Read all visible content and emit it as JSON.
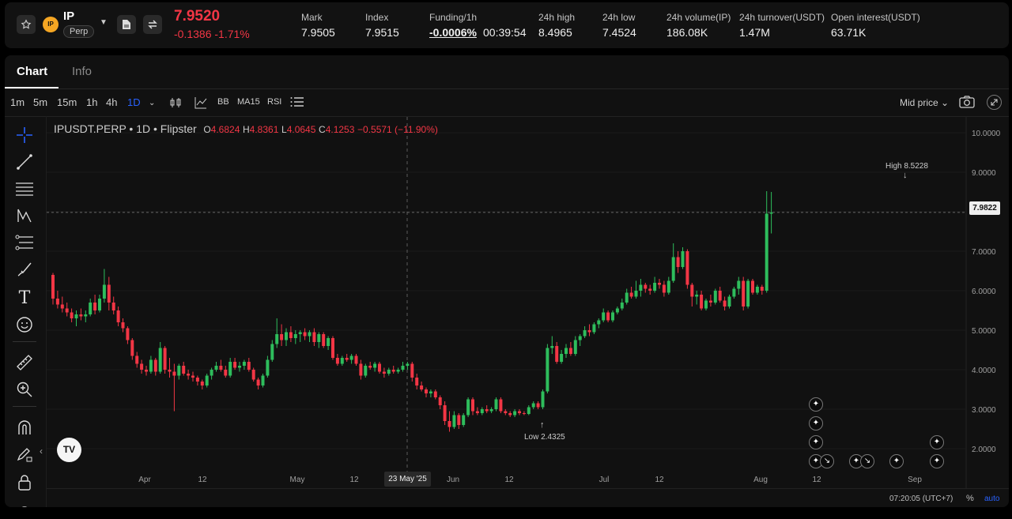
{
  "ticker": {
    "symbol": "IP",
    "type_badge": "Perp",
    "last_price": "7.9520",
    "change": "-0.1386",
    "change_pct": "-1.71%",
    "stats": [
      {
        "label": "Mark",
        "value": "7.9505"
      },
      {
        "label": "Index",
        "value": "7.9515"
      },
      {
        "label": "Funding/1h",
        "value": "-0.0006%",
        "extra": "00:39:54"
      },
      {
        "label": "24h high",
        "value": "8.4965"
      },
      {
        "label": "24h low",
        "value": "7.4524"
      },
      {
        "label": "24h volume(IP)",
        "value": "186.08K"
      },
      {
        "label": "24h turnover(USDT)",
        "value": "1.47M"
      },
      {
        "label": "Open interest(USDT)",
        "value": "63.71K"
      }
    ]
  },
  "tabs": [
    "Chart",
    "Info"
  ],
  "toolbar": {
    "intervals": [
      "1m",
      "5m",
      "15m",
      "1h",
      "4h",
      "1D"
    ],
    "active_interval": "1D",
    "indicators": [
      "BB",
      "MA15",
      "RSI"
    ],
    "price_source": "Mid price"
  },
  "legend": {
    "title": "IPUSDT.PERP • 1D • Flipster",
    "o_label": "O",
    "o": "4.6824",
    "h_label": "H",
    "h": "4.8361",
    "l_label": "L",
    "l": "4.0645",
    "c_label": "C",
    "c": "4.1253",
    "change": "−0.5571 (−11.90%)"
  },
  "annotations": {
    "high": "High 8.5228",
    "low": "Low 2.4325"
  },
  "crosshair_date": "23 May '25",
  "current_price_label": "7.9822",
  "footer": {
    "time": "07:20:05 (UTC+7)",
    "pct": "%",
    "auto": "auto"
  },
  "colors": {
    "up": "#2ebd5c",
    "down": "#f23645",
    "accent": "#2962ff",
    "bg": "#111111"
  },
  "chart_data": {
    "type": "candlestick",
    "y_ticks": [
      "10.0000",
      "9.0000",
      "8.0000",
      "7.0000",
      "6.0000",
      "5.0000",
      "4.0000",
      "3.0000",
      "2.0000"
    ],
    "ylim": [
      1.0,
      10.4
    ],
    "x_ticks": [
      "Apr",
      "12",
      "May",
      "12",
      "Jun",
      "12",
      "Jul",
      "12",
      "Aug",
      "12",
      "Sep"
    ],
    "candles": [
      [
        6.4,
        6.45,
        5.65,
        5.8
      ],
      [
        5.8,
        6.0,
        5.55,
        5.65
      ],
      [
        5.65,
        5.85,
        5.45,
        5.55
      ],
      [
        5.55,
        5.7,
        5.35,
        5.45
      ],
      [
        5.45,
        5.55,
        5.2,
        5.3
      ],
      [
        5.3,
        5.5,
        5.1,
        5.4
      ],
      [
        5.4,
        5.55,
        5.25,
        5.35
      ],
      [
        5.35,
        5.5,
        5.2,
        5.4
      ],
      [
        5.4,
        5.8,
        5.35,
        5.7
      ],
      [
        5.7,
        5.9,
        5.4,
        5.5
      ],
      [
        5.5,
        5.9,
        5.45,
        5.8
      ],
      [
        5.8,
        6.55,
        5.7,
        6.15
      ],
      [
        6.15,
        6.35,
        5.5,
        5.7
      ],
      [
        5.7,
        5.85,
        5.4,
        5.5
      ],
      [
        5.5,
        5.6,
        5.1,
        5.2
      ],
      [
        5.2,
        5.3,
        4.95,
        5.05
      ],
      [
        5.05,
        5.1,
        4.65,
        4.75
      ],
      [
        4.75,
        4.8,
        4.25,
        4.35
      ],
      [
        4.35,
        4.45,
        4.05,
        4.15
      ],
      [
        4.15,
        4.25,
        3.9,
        4.0
      ],
      [
        4.0,
        4.1,
        3.85,
        3.95
      ],
      [
        3.95,
        4.35,
        3.9,
        4.25
      ],
      [
        4.25,
        4.3,
        3.85,
        3.95
      ],
      [
        3.95,
        4.7,
        3.9,
        4.55
      ],
      [
        4.55,
        4.6,
        3.9,
        4.0
      ],
      [
        4.0,
        4.3,
        3.8,
        3.95
      ],
      [
        3.95,
        4.15,
        2.95,
        3.85
      ],
      [
        3.85,
        4.15,
        3.75,
        4.1
      ],
      [
        4.1,
        4.2,
        3.85,
        3.9
      ],
      [
        3.9,
        4.0,
        3.75,
        3.85
      ],
      [
        3.85,
        3.95,
        3.7,
        3.8
      ],
      [
        3.8,
        3.85,
        3.6,
        3.7
      ],
      [
        3.7,
        3.75,
        3.5,
        3.6
      ],
      [
        3.6,
        3.9,
        3.55,
        3.85
      ],
      [
        3.85,
        4.05,
        3.75,
        4.0
      ],
      [
        4.0,
        4.2,
        3.95,
        4.1
      ],
      [
        4.1,
        4.25,
        3.95,
        4.0
      ],
      [
        4.0,
        4.1,
        3.8,
        3.85
      ],
      [
        3.85,
        4.3,
        3.8,
        4.2
      ],
      [
        4.2,
        4.3,
        4.0,
        4.05
      ],
      [
        4.05,
        4.2,
        3.95,
        4.1
      ],
      [
        4.1,
        4.25,
        4.0,
        4.2
      ],
      [
        4.2,
        4.3,
        3.95,
        4.0
      ],
      [
        4.0,
        4.05,
        3.7,
        3.75
      ],
      [
        3.75,
        3.8,
        3.5,
        3.6
      ],
      [
        3.6,
        3.9,
        3.55,
        3.85
      ],
      [
        3.85,
        4.35,
        3.8,
        4.25
      ],
      [
        4.25,
        4.75,
        4.2,
        4.65
      ],
      [
        4.65,
        5.3,
        4.55,
        4.9
      ],
      [
        4.9,
        5.15,
        4.6,
        4.75
      ],
      [
        4.75,
        5.05,
        4.6,
        4.95
      ],
      [
        4.95,
        5.1,
        4.7,
        4.8
      ],
      [
        4.8,
        5.0,
        4.65,
        4.9
      ],
      [
        4.9,
        5.0,
        4.7,
        4.95
      ],
      [
        4.95,
        5.05,
        4.75,
        4.85
      ],
      [
        4.85,
        5.0,
        4.7,
        4.95
      ],
      [
        4.95,
        5.05,
        4.6,
        4.7
      ],
      [
        4.7,
        4.95,
        4.55,
        4.9
      ],
      [
        4.9,
        4.95,
        4.55,
        4.6
      ],
      [
        4.6,
        4.85,
        4.5,
        4.8
      ],
      [
        4.8,
        4.85,
        4.25,
        4.3
      ],
      [
        4.3,
        4.4,
        4.1,
        4.15
      ],
      [
        4.15,
        4.35,
        4.1,
        4.3
      ],
      [
        4.3,
        4.4,
        4.2,
        4.25
      ],
      [
        4.25,
        4.4,
        4.15,
        4.35
      ],
      [
        4.35,
        4.4,
        4.1,
        4.15
      ],
      [
        4.15,
        4.25,
        3.75,
        3.85
      ],
      [
        3.85,
        4.15,
        3.8,
        4.1
      ],
      [
        4.1,
        4.2,
        4.0,
        4.05
      ],
      [
        4.05,
        4.2,
        3.95,
        4.15
      ],
      [
        4.15,
        4.2,
        3.9,
        3.95
      ],
      [
        3.95,
        4.05,
        3.8,
        3.9
      ],
      [
        3.9,
        4.05,
        3.85,
        4.0
      ],
      [
        4.0,
        4.1,
        3.9,
        3.95
      ],
      [
        3.95,
        4.05,
        3.9,
        4.0
      ],
      [
        4.0,
        4.2,
        3.95,
        4.1
      ],
      [
        4.1,
        4.2,
        4.0,
        4.15
      ],
      [
        4.15,
        4.2,
        3.7,
        3.8
      ],
      [
        3.8,
        3.9,
        3.5,
        3.6
      ],
      [
        3.6,
        3.7,
        3.45,
        3.5
      ],
      [
        3.5,
        3.55,
        3.3,
        3.4
      ],
      [
        3.4,
        3.5,
        3.3,
        3.45
      ],
      [
        3.45,
        3.5,
        3.25,
        3.3
      ],
      [
        3.3,
        3.35,
        3.0,
        3.1
      ],
      [
        3.1,
        3.2,
        2.6,
        2.7
      ],
      [
        2.7,
        2.95,
        2.43,
        2.55
      ],
      [
        2.55,
        2.95,
        2.5,
        2.85
      ],
      [
        2.85,
        2.9,
        2.5,
        2.6
      ],
      [
        2.6,
        2.9,
        2.55,
        2.85
      ],
      [
        2.85,
        3.3,
        2.8,
        3.25
      ],
      [
        3.25,
        3.3,
        2.85,
        2.95
      ],
      [
        2.95,
        3.05,
        2.85,
        2.9
      ],
      [
        2.9,
        3.05,
        2.85,
        3.0
      ],
      [
        3.0,
        3.1,
        2.9,
        2.95
      ],
      [
        2.95,
        3.05,
        2.9,
        3.0
      ],
      [
        3.0,
        3.3,
        2.95,
        3.25
      ],
      [
        3.25,
        3.3,
        2.9,
        2.95
      ],
      [
        2.95,
        3.0,
        2.85,
        2.9
      ],
      [
        2.9,
        2.95,
        2.8,
        2.85
      ],
      [
        2.85,
        3.0,
        2.8,
        2.95
      ],
      [
        2.95,
        3.0,
        2.85,
        2.9
      ],
      [
        2.9,
        2.95,
        2.85,
        2.88
      ],
      [
        2.88,
        3.1,
        2.85,
        3.05
      ],
      [
        3.05,
        3.2,
        3.0,
        3.15
      ],
      [
        3.15,
        3.2,
        3.0,
        3.05
      ],
      [
        3.05,
        3.5,
        3.0,
        3.45
      ],
      [
        3.45,
        4.65,
        3.4,
        4.55
      ],
      [
        4.55,
        4.85,
        4.4,
        4.6
      ],
      [
        4.6,
        4.7,
        4.15,
        4.2
      ],
      [
        4.2,
        4.5,
        4.15,
        4.4
      ],
      [
        4.4,
        4.65,
        4.3,
        4.55
      ],
      [
        4.55,
        4.7,
        4.35,
        4.4
      ],
      [
        4.4,
        4.85,
        4.35,
        4.75
      ],
      [
        4.75,
        4.9,
        4.6,
        4.85
      ],
      [
        4.85,
        5.1,
        4.8,
        5.0
      ],
      [
        5.0,
        5.15,
        4.85,
        4.95
      ],
      [
        4.95,
        5.2,
        4.9,
        5.15
      ],
      [
        5.15,
        5.3,
        5.05,
        5.25
      ],
      [
        5.25,
        5.55,
        5.2,
        5.45
      ],
      [
        5.45,
        5.5,
        5.2,
        5.25
      ],
      [
        5.25,
        5.5,
        5.2,
        5.45
      ],
      [
        5.45,
        5.6,
        5.4,
        5.55
      ],
      [
        5.55,
        5.8,
        5.5,
        5.7
      ],
      [
        5.7,
        6.05,
        5.65,
        5.95
      ],
      [
        5.95,
        6.1,
        5.8,
        5.85
      ],
      [
        5.85,
        6.25,
        5.8,
        6.0
      ],
      [
        6.0,
        6.3,
        5.85,
        6.15
      ],
      [
        6.15,
        6.2,
        5.95,
        6.05
      ],
      [
        6.05,
        6.15,
        5.9,
        6.0
      ],
      [
        6.0,
        6.35,
        5.95,
        6.2
      ],
      [
        6.2,
        6.3,
        6.05,
        6.15
      ],
      [
        6.15,
        6.25,
        5.85,
        5.95
      ],
      [
        5.95,
        6.35,
        5.9,
        6.25
      ],
      [
        6.25,
        7.2,
        6.2,
        6.85
      ],
      [
        6.85,
        7.0,
        6.45,
        6.6
      ],
      [
        6.6,
        7.1,
        6.55,
        7.0
      ],
      [
        7.0,
        7.05,
        6.05,
        6.15
      ],
      [
        6.15,
        6.2,
        5.6,
        5.85
      ],
      [
        5.85,
        6.0,
        5.65,
        5.9
      ],
      [
        5.9,
        6.0,
        5.5,
        5.55
      ],
      [
        5.55,
        5.8,
        5.5,
        5.75
      ],
      [
        5.75,
        5.9,
        5.6,
        5.7
      ],
      [
        5.7,
        6.05,
        5.65,
        6.0
      ],
      [
        6.0,
        6.1,
        5.7,
        5.75
      ],
      [
        5.75,
        5.85,
        5.5,
        5.6
      ],
      [
        5.6,
        5.9,
        5.55,
        5.85
      ],
      [
        5.85,
        6.1,
        5.8,
        6.05
      ],
      [
        6.05,
        6.35,
        5.9,
        6.25
      ],
      [
        6.25,
        6.35,
        5.5,
        5.6
      ],
      [
        5.6,
        6.3,
        5.55,
        6.25
      ],
      [
        6.25,
        6.3,
        5.9,
        5.95
      ],
      [
        5.95,
        6.15,
        5.9,
        6.1
      ],
      [
        6.1,
        6.15,
        5.9,
        6.0
      ],
      [
        6.0,
        8.52,
        5.95,
        7.95
      ],
      [
        7.95,
        8.5,
        7.45,
        7.98
      ]
    ]
  }
}
